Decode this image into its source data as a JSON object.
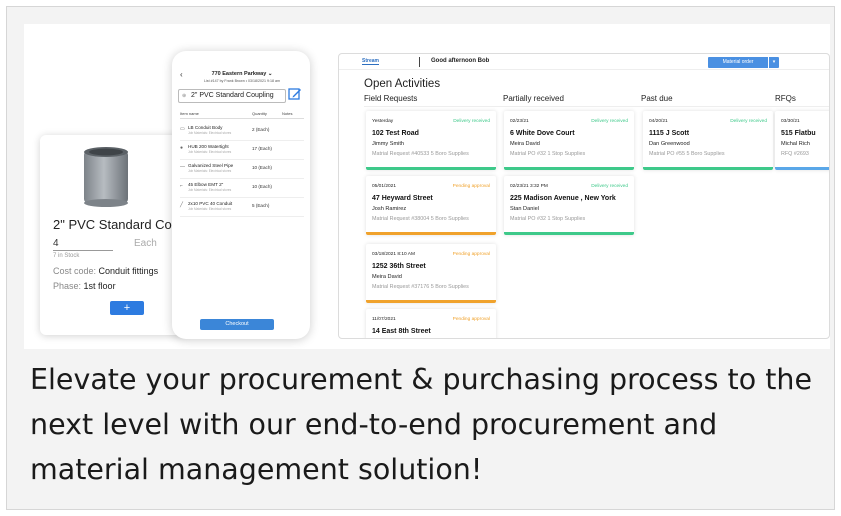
{
  "colors": {
    "green": "#3ec98a",
    "orange": "#f0a22c",
    "blue": "#5aa7e8",
    "accent": "#2d7be0"
  },
  "product_card": {
    "name": "2\" PVC Standard Coupling",
    "quantity": "4",
    "unit": "Each",
    "stock": "7 in Stock",
    "cost_code_label": "Cost code:",
    "cost_code_value": "Conduit fittings",
    "phase_label": "Phase:",
    "phase_value": "1st floor",
    "add_label": "+"
  },
  "phone": {
    "back": "‹",
    "address": "770 Eastern Parkway ⌄",
    "subtitle": "List #147 by Frank Brown • 03/18/2021 9:18 am",
    "search_value": "2\" PVC Standard Coupling",
    "columns": {
      "name": "Item name",
      "quantity": "Quantity",
      "notes": "Notes"
    },
    "items": [
      {
        "name": "LB Conduit Body",
        "maker": "Job Materials: Electrical stores",
        "qty": "2 (Each)"
      },
      {
        "name": "HUB 200 Watertight",
        "maker": "Job Materials: Electrical stores",
        "qty": "17 (Each)"
      },
      {
        "name": "Galvanized Steel Pipe",
        "maker": "Job Materials: Electrical stores",
        "qty": "10 (Each)"
      },
      {
        "name": "45 Elbow EMT 2\"",
        "maker": "Job Materials: Electrical stores",
        "qty": "10 (Each)"
      },
      {
        "name": "2x10 PVC 40 Conduit",
        "maker": "Job Materials: Electrical stores",
        "qty": "5 (Each)"
      }
    ],
    "checkout": "Checkout"
  },
  "dashboard": {
    "logo": "Stream",
    "greeting": "Good afternoon Bob",
    "material_order": "Material order",
    "caret": "▾",
    "title": "Open Activities",
    "columns": [
      "Field Requests",
      "Partially received",
      "Past due",
      "RFQs"
    ],
    "tiles": [
      {
        "col": 0,
        "row": 0,
        "date": "Yesterday",
        "status": "Delivery received",
        "status_color": "green",
        "address": "102 Test Road",
        "person": "Jimmy Smith",
        "ref": "Matrial Request #40533 5 Boro Supplies"
      },
      {
        "col": 0,
        "row": 1,
        "date": "05/01/2021",
        "status": "Pending approval",
        "status_color": "orange",
        "address": "47 Heyward Street",
        "person": "Josh Ramirez",
        "ref": "Matrial Request #38004 5 Boro Supplies"
      },
      {
        "col": 0,
        "row": 2,
        "date": "03/18/2021 8:10 AM",
        "status": "Pending approval",
        "status_color": "orange",
        "address": "1252 36th Street",
        "person": "Meira David",
        "ref": "Matrial Request #37176 5 Boro Supplies"
      },
      {
        "col": 0,
        "row": 3,
        "date": "11/07/2021",
        "status": "Pending approval",
        "status_color": "orange",
        "address": "14 East 8th Street",
        "person": "",
        "ref": ""
      },
      {
        "col": 1,
        "row": 0,
        "date": "02/23/21",
        "status": "Delivery received",
        "status_color": "green",
        "address": "6 White Dove Court",
        "person": "Meira David",
        "ref": "Matrial PO #32 1 Stop Supplies"
      },
      {
        "col": 1,
        "row": 1,
        "date": "02/23/21 3:32 PM",
        "status": "Delivery received",
        "status_color": "green",
        "address": "225 Madison Avenue , New York",
        "person": "Stan Daniel",
        "ref": "Matrial PO #32 1 Stop Supplies"
      },
      {
        "col": 2,
        "row": 0,
        "date": "04/20/21",
        "status": "Delivery received",
        "status_color": "green",
        "address": "1115 J Scott",
        "person": "Dan Greenwood",
        "ref": "Matrial PO #55 5 Boro Supplies"
      },
      {
        "col": 3,
        "row": 0,
        "date": "03/30/21",
        "status": "",
        "status_color": "blue",
        "address": "515 Flatbu",
        "person": "Michal Rich",
        "ref": "RFQ #2693"
      }
    ]
  },
  "caption": "Elevate your procurement & purchasing process to the next level with our end-to-end procurement and material management solution!"
}
